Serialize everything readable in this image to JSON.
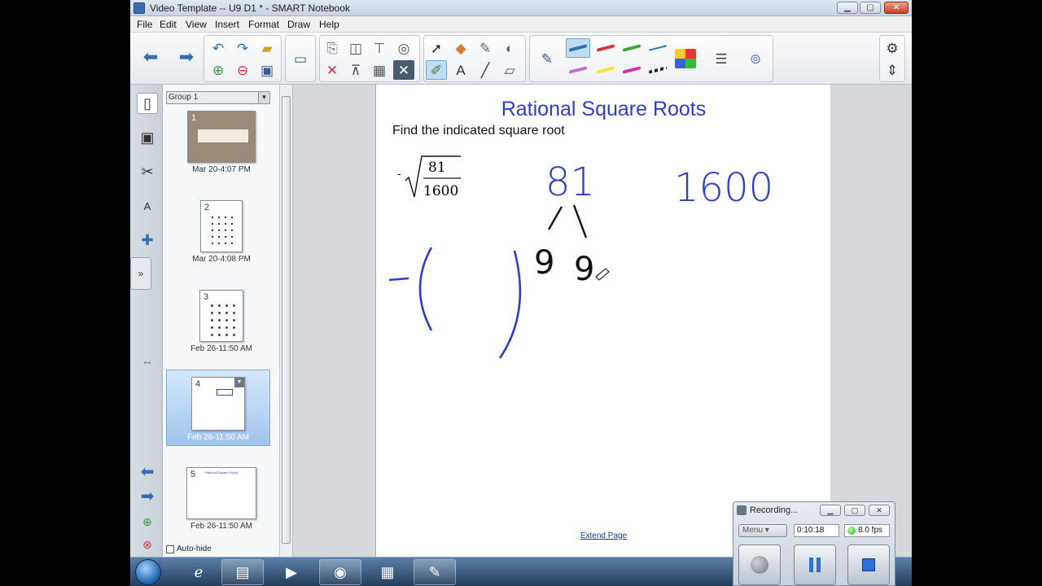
{
  "window": {
    "title": "Video Template -- U9 D1 * - SMART Notebook",
    "controls": {
      "minimize": "▁",
      "maximize": "▢",
      "close": "✕"
    }
  },
  "menu": [
    "File",
    "Edit",
    "View",
    "Insert",
    "Format",
    "Draw",
    "Help"
  ],
  "toolbar": {
    "nav": [
      "left-arrow-icon",
      "right-arrow-icon"
    ],
    "file_tools": [
      "undo-icon",
      "redo-icon",
      "open-folder-icon",
      "add-page-icon",
      "delete-page-icon",
      "save-icon"
    ],
    "screen_tools": [
      "screen-shade-icon"
    ],
    "edit_tools": [
      "paste-icon",
      "screen-capture-icon",
      "show-page-icon",
      "delete-icon",
      "table-icon",
      "delete-table-icon"
    ],
    "pen_colors": [
      "#2f6fb6",
      "#d8323c",
      "#3ea13e",
      "#2f6fb6",
      "#c86ac8",
      "#f2e33b",
      "#d02fb0",
      "#222222"
    ],
    "accent_color": "#6ea5d3"
  },
  "sorter": {
    "group": "Group 1",
    "pages": [
      {
        "number": "1",
        "caption": "Mar 20-4:07 PM"
      },
      {
        "number": "2",
        "caption": "Mar 20-4:08 PM"
      },
      {
        "number": "3",
        "caption": "Feb 26-11:50 AM"
      },
      {
        "number": "4",
        "caption": "Feb 26-11:50 AM",
        "selected": true
      },
      {
        "number": "5",
        "caption": "Feb 26-11:50 AM",
        "mini_title": "Rational Square Roots"
      }
    ],
    "autohide_label": "Auto-hide"
  },
  "page": {
    "title": "Rational Square Roots",
    "instruction": "Find the indicated square root",
    "expression": {
      "sign": "-",
      "numerator": "81",
      "denominator": "1600"
    },
    "ink_text": [
      "81",
      "1600",
      "9",
      "9",
      "-"
    ],
    "extend_label": "Extend Page"
  },
  "recorder": {
    "title": "Recording...",
    "menu_label": "Menu",
    "elapsed": "0:10:18",
    "fps": "8.0 fps"
  },
  "taskbar": {
    "apps": [
      "internet-explorer-icon",
      "folder-icon",
      "media-player-icon",
      "recorder-icon",
      "calculator-icon",
      "smart-notebook-icon"
    ]
  }
}
